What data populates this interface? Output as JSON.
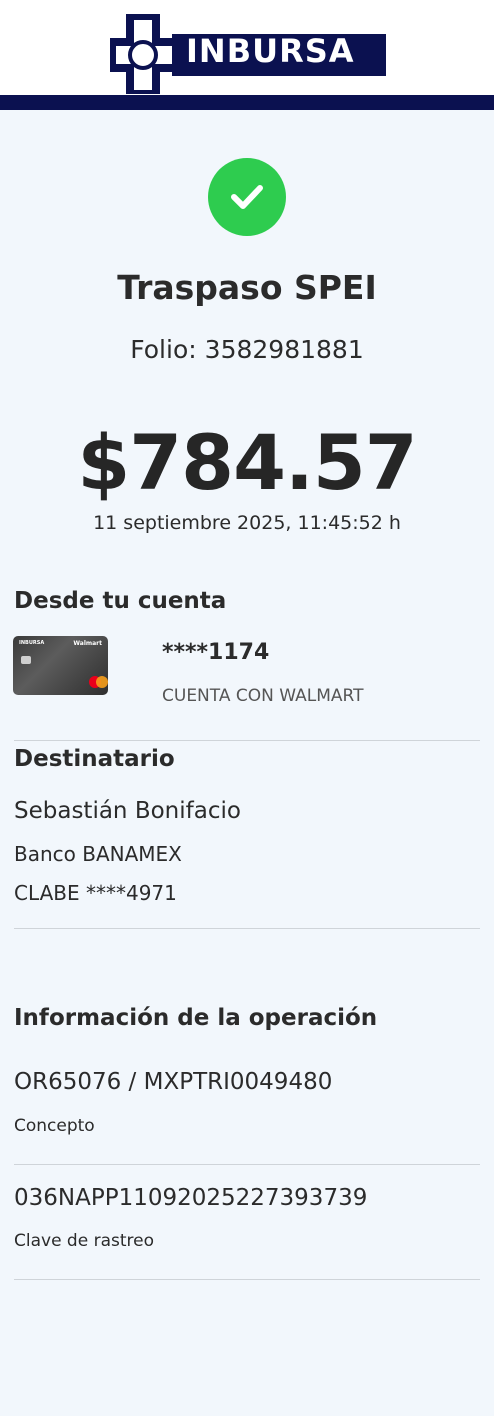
{
  "header": {
    "brand": "INBURSA",
    "colors": {
      "navy": "#0b1150",
      "white": "#ffffff"
    }
  },
  "status": {
    "icon": "check-icon",
    "color": "#2ecc4f"
  },
  "title": "Traspaso SPEI",
  "folio": {
    "label": "Folio:",
    "value": "3582981881"
  },
  "amount": "$784.57",
  "datetime": "11 septiembre 2025, 11:45:52 h",
  "from_account": {
    "section_title": "Desde tu cuenta",
    "card_brand": "INBURSA",
    "card_partner": "Walmart",
    "number": "****1174",
    "name": "CUENTA CON WALMART"
  },
  "recipient": {
    "section_title": "Destinatario",
    "name": "Sebastián Bonifacio",
    "bank": "Banco BANAMEX",
    "clabe": "CLABE ****4971"
  },
  "operation": {
    "section_title": "Información de la operación",
    "concept_value": "OR65076 / MXPTRI0049480",
    "concept_label": "Concepto",
    "tracking_value": "036NAPP11092025227393739",
    "tracking_label": "Clave de rastreo"
  }
}
